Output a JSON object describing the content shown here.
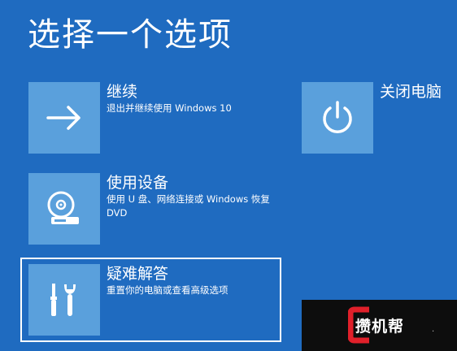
{
  "page": {
    "title": "选择一个选项"
  },
  "options": {
    "continue": {
      "title": "继续",
      "desc": "退出并继续使用 Windows 10",
      "icon": "arrow-right-icon"
    },
    "use_device": {
      "title": "使用设备",
      "desc": "使用 U 盘、网络连接或 Windows 恢复 DVD",
      "icon": "disc-drive-icon"
    },
    "troubleshoot": {
      "title": "疑难解答",
      "desc": "重置你的电脑或查看高级选项",
      "icon": "tools-icon"
    },
    "shutdown": {
      "title": "关闭电脑",
      "icon": "power-icon"
    }
  },
  "watermark": {
    "text": "攒机帮",
    "dot": "·",
    "logo": "C-logo"
  },
  "colors": {
    "background": "#1f6bc0",
    "tile": "#5aa0dc",
    "text": "#ffffff"
  }
}
